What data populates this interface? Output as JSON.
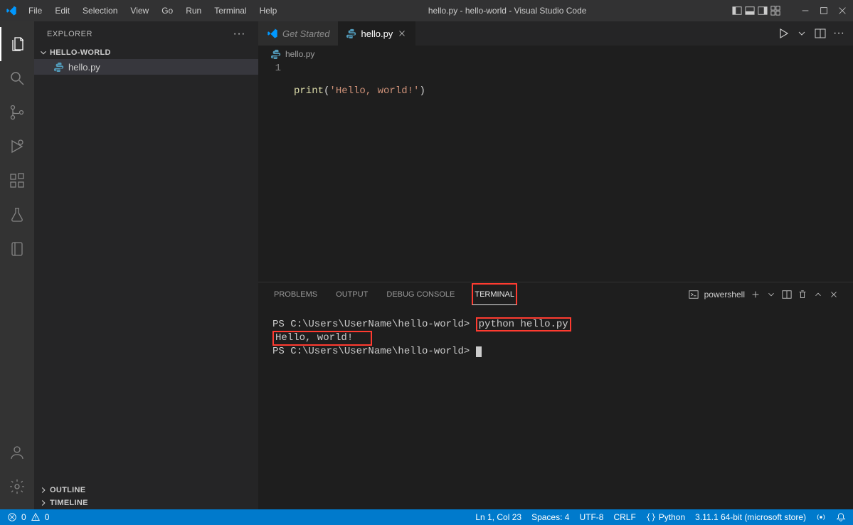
{
  "titlebar": {
    "menu": [
      "File",
      "Edit",
      "Selection",
      "View",
      "Go",
      "Run",
      "Terminal",
      "Help"
    ],
    "title": "hello.py - hello-world - Visual Studio Code"
  },
  "sidebar": {
    "header": "EXPLORER",
    "root_label": "HELLO-WORLD",
    "file": "hello.py",
    "sections": [
      "OUTLINE",
      "TIMELINE"
    ]
  },
  "tabs": {
    "inactive_label": "Get Started",
    "active_label": "hello.py"
  },
  "breadcrumb": {
    "file": "hello.py"
  },
  "editor": {
    "line_number": "1",
    "code_fn": "print",
    "code_open": "(",
    "code_str": "'Hello, world!'",
    "code_close": ")"
  },
  "panel": {
    "tabs": [
      "PROBLEMS",
      "OUTPUT",
      "DEBUG CONSOLE",
      "TERMINAL"
    ],
    "shell_label": "powershell",
    "terminal": {
      "prompt1": "PS C:\\Users\\UserName\\hello-world>",
      "command": "python hello.py",
      "output": "Hello, world!",
      "prompt2": "PS C:\\Users\\UserName\\hello-world>"
    }
  },
  "statusbar": {
    "errors": "0",
    "warnings": "0",
    "position": "Ln 1, Col 23",
    "spaces": "Spaces: 4",
    "encoding": "UTF-8",
    "eol": "CRLF",
    "language": "Python",
    "python_version": "3.11.1 64-bit (microsoft store)"
  }
}
